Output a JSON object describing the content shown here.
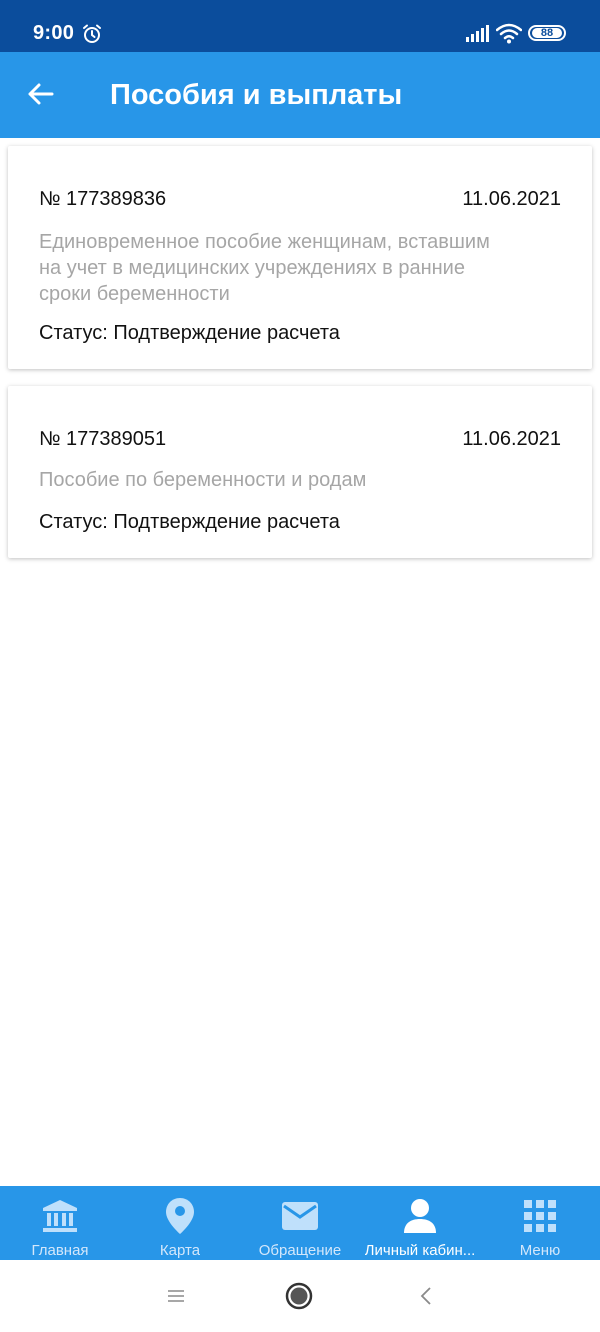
{
  "status_bar": {
    "time": "9:00",
    "battery": "88",
    "icons": [
      "alarm-icon",
      "signal-icon",
      "wifi-icon",
      "battery-icon"
    ]
  },
  "header": {
    "title": "Пособия и выплаты",
    "back_icon": "arrow-left-icon"
  },
  "cards": [
    {
      "number": "№ 177389836",
      "date": "11.06.2021",
      "description_lines": [
        "Единовременное пособие женщинам, вставшим",
        "на учет в медицинских учреждениях в ранние",
        "сроки беременности"
      ],
      "status": "Статус: Подтверждение расчета"
    },
    {
      "number": "№ 177389051",
      "date": "11.06.2021",
      "description_lines": [
        "Пособие по беременности и родам"
      ],
      "status": "Статус: Подтверждение расчета"
    }
  ],
  "bottom_nav": [
    {
      "label": "Главная",
      "icon": "bank-icon",
      "active": false
    },
    {
      "label": "Карта",
      "icon": "map-pin-icon",
      "active": false
    },
    {
      "label": "Обращение",
      "icon": "envelope-icon",
      "active": false
    },
    {
      "label": "Личный кабин...",
      "icon": "person-icon",
      "active": true
    },
    {
      "label": "Меню",
      "icon": "grid-icon",
      "active": false
    }
  ],
  "colors": {
    "status_bar": "#0b4d9c",
    "app_bar": "#2896e8",
    "bottom_nav": "#2896e8",
    "nav_icon_inactive": "#bfe0fb",
    "nav_icon_active": "#ffffff",
    "description_text": "#a6a6a6"
  }
}
